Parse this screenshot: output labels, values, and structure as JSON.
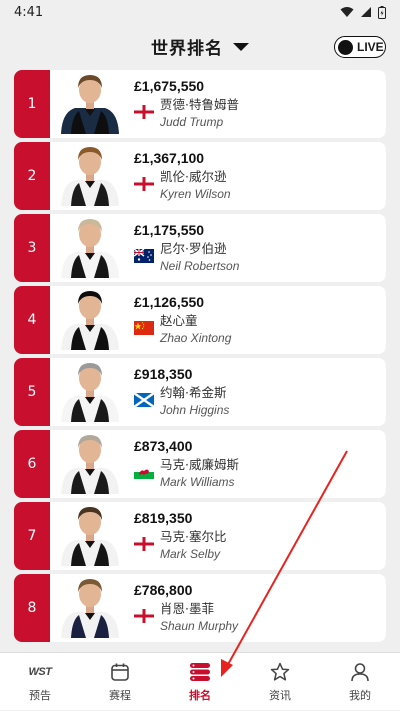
{
  "status_bar": {
    "time": "4:41"
  },
  "header": {
    "title": "世界排名",
    "live_label": "LIVE"
  },
  "colors": {
    "accent": "#c8102e"
  },
  "rankings": [
    {
      "rank": "1",
      "prize": "£1,675,550",
      "name_cn": "贾德·特鲁姆普",
      "name_en": "Judd Trump",
      "flag": "england",
      "shirt": "#1a2c44",
      "vest": "#0e0e0e",
      "hair": "#6b4a2a"
    },
    {
      "rank": "2",
      "prize": "£1,367,100",
      "name_cn": "凯伦·威尔逊",
      "name_en": "Kyren Wilson",
      "flag": "england",
      "shirt": "#f2f2f2",
      "vest": "#1b1b1b",
      "hair": "#8a5a2b"
    },
    {
      "rank": "3",
      "prize": "£1,175,550",
      "name_cn": "尼尔·罗伯逊",
      "name_en": "Neil Robertson",
      "flag": "australia",
      "shirt": "#f5f5f5",
      "vest": "#161616",
      "hair": "#c9b99a"
    },
    {
      "rank": "4",
      "prize": "£1,126,550",
      "name_cn": "赵心童",
      "name_en": "Zhao Xintong",
      "flag": "china",
      "shirt": "#f2f2f2",
      "vest": "#101010",
      "hair": "#0d0d0d"
    },
    {
      "rank": "5",
      "prize": "£918,350",
      "name_cn": "约翰·希金斯",
      "name_en": "John Higgins",
      "flag": "scotland",
      "shirt": "#f5f5f5",
      "vest": "#1a1a1a",
      "hair": "#9a9a9a"
    },
    {
      "rank": "6",
      "prize": "£873,400",
      "name_cn": "马克·威廉姆斯",
      "name_en": "Mark Williams",
      "flag": "wales",
      "shirt": "#f2f2f2",
      "vest": "#1a1a1a",
      "hair": "#b0a89a"
    },
    {
      "rank": "7",
      "prize": "£819,350",
      "name_cn": "马克·塞尔比",
      "name_en": "Mark Selby",
      "flag": "england",
      "shirt": "#f2f2f2",
      "vest": "#151515",
      "hair": "#4a3320"
    },
    {
      "rank": "8",
      "prize": "£786,800",
      "name_cn": "肖恩·墨菲",
      "name_en": "Shaun Murphy",
      "flag": "england",
      "shirt": "#f2f2f2",
      "vest": "#1a2040",
      "hair": "#7a5a35"
    }
  ],
  "nav": [
    {
      "label": "预告",
      "icon": "wst-logo-icon",
      "logo_text": "WST",
      "active": false
    },
    {
      "label": "赛程",
      "icon": "calendar-icon",
      "active": false
    },
    {
      "label": "排名",
      "icon": "rankings-stack-icon",
      "active": true
    },
    {
      "label": "资讯",
      "icon": "star-icon",
      "active": false
    },
    {
      "label": "我的",
      "icon": "profile-icon",
      "active": false
    }
  ]
}
